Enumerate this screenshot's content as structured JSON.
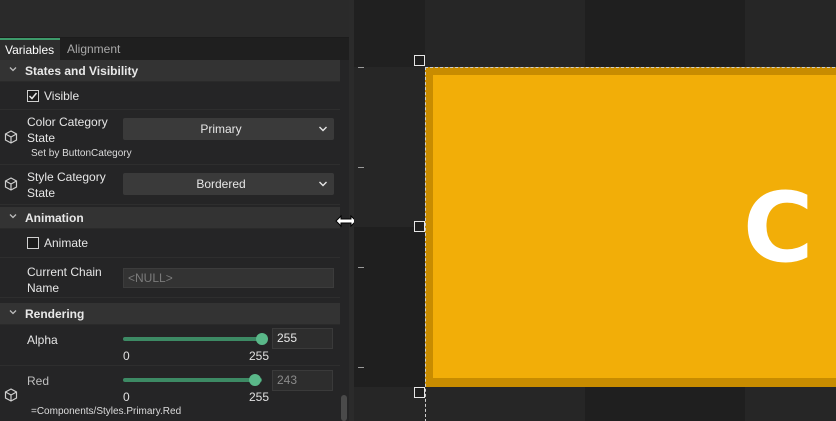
{
  "tabs": [
    {
      "label": "Variables",
      "active": true
    },
    {
      "label": "Alignment",
      "active": false
    }
  ],
  "sections": {
    "states": {
      "title": "States and Visibility",
      "visible_label": "Visible",
      "visible_checked": true,
      "color_category": {
        "label_line1": "Color Category",
        "label_line2": "State",
        "value": "Primary",
        "note": "Set by ButtonCategory"
      },
      "style_category": {
        "label_line1": "Style Category",
        "label_line2": "State",
        "value": "Bordered"
      }
    },
    "animation": {
      "title": "Animation",
      "animate_label": "Animate",
      "animate_checked": false,
      "chain_label_line1": "Current Chain",
      "chain_label_line2": "Name",
      "chain_placeholder": "<NULL>"
    },
    "rendering": {
      "title": "Rendering",
      "alpha": {
        "label": "Alpha",
        "value": "255",
        "min": "0",
        "max": "255",
        "fraction": 1.0
      },
      "red": {
        "label": "Red",
        "value": "243",
        "min": "0",
        "max": "255",
        "fraction": 0.953,
        "note": "=Components/Styles.Primary.Red"
      }
    }
  },
  "canvas": {
    "button_text": "C",
    "button_color": "#f2ae08",
    "accent_color": "#3d9a6a"
  },
  "icons": [
    "chevron-down-icon",
    "cube-icon",
    "caret-down-icon",
    "checkmark-icon",
    "resize-horizontal-icon"
  ]
}
